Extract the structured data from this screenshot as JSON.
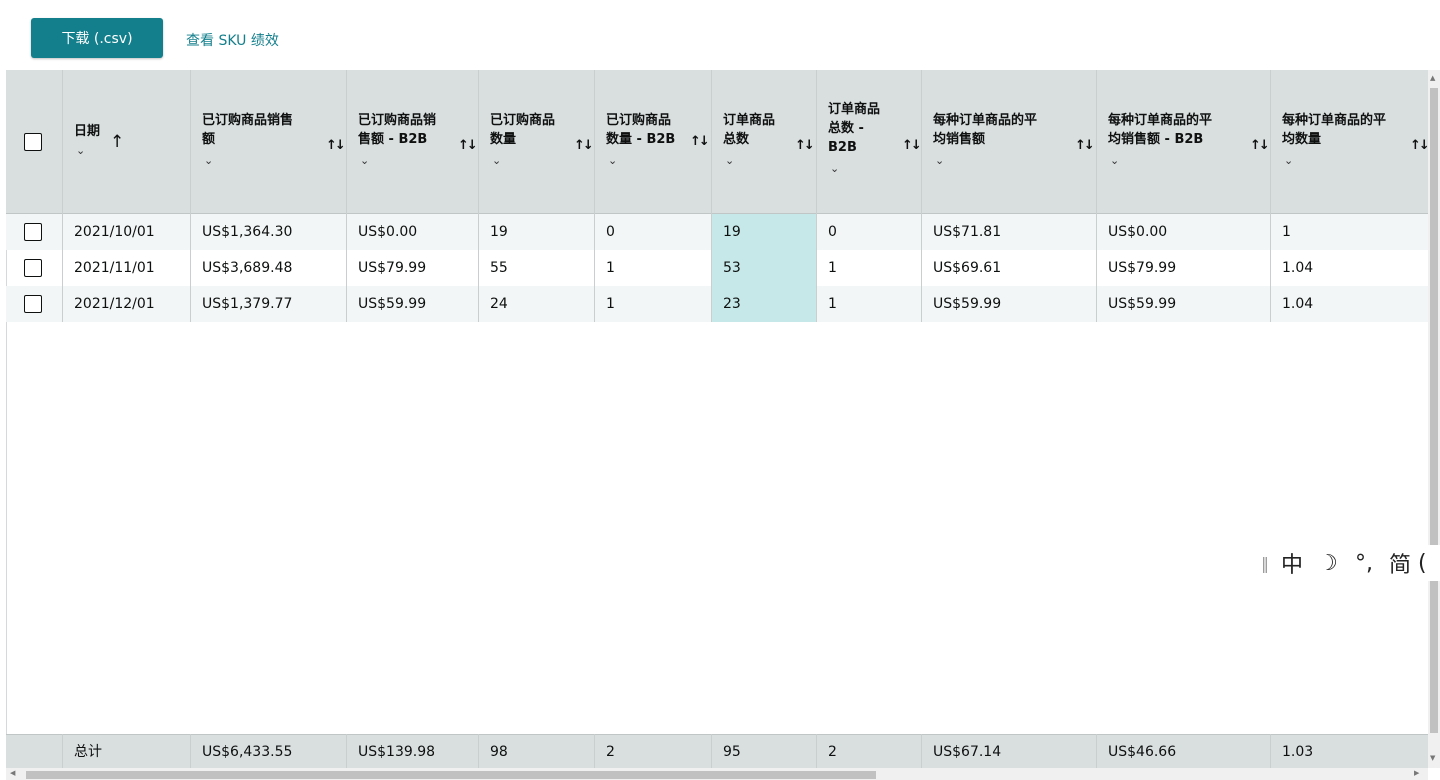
{
  "toolbar": {
    "download_label": "下载 (.csv)",
    "sku_link_label": "查看 SKU 绩效"
  },
  "table": {
    "headers": {
      "date": {
        "line1": "日期"
      },
      "ordered_sales": {
        "line1": "已订购商品销售",
        "line2": "额"
      },
      "ordered_sales_b2b": {
        "line1": "已订购商品销",
        "line2": "售额 - B2B"
      },
      "units_ordered": {
        "line1": "已订购商品",
        "line2": "数量"
      },
      "units_ordered_b2b": {
        "line1": "已订购商品",
        "line2": "数量 - B2B"
      },
      "total_order_items": {
        "line1": "订单商品",
        "line2": "总数"
      },
      "total_order_items_b2b": {
        "line1": "订单商品",
        "line2": "总数 -",
        "line3": "B2B"
      },
      "avg_sales_per_item": {
        "line1": "每种订单商品的平",
        "line2": "均销售额"
      },
      "avg_sales_per_item_b2b": {
        "line1": "每种订单商品的平",
        "line2": "均销售额 - B2B"
      },
      "avg_units_per_item": {
        "line1": "每种订单商品的平",
        "line2": "均数量"
      }
    },
    "sort_indicator_glyph": "↑↓",
    "asc_glyph": "↑",
    "chevron_glyph": "⌄",
    "rows": [
      {
        "date": "2021/10/01",
        "ordered_sales": "US$1,364.30",
        "ordered_sales_b2b": "US$0.00",
        "units_ordered": "19",
        "units_ordered_b2b": "0",
        "total_order_items": "19",
        "total_order_items_b2b": "0",
        "avg_sales_per_item": "US$71.81",
        "avg_sales_per_item_b2b": "US$0.00",
        "avg_units_per_item": "1"
      },
      {
        "date": "2021/11/01",
        "ordered_sales": "US$3,689.48",
        "ordered_sales_b2b": "US$79.99",
        "units_ordered": "55",
        "units_ordered_b2b": "1",
        "total_order_items": "53",
        "total_order_items_b2b": "1",
        "avg_sales_per_item": "US$69.61",
        "avg_sales_per_item_b2b": "US$79.99",
        "avg_units_per_item": "1.04"
      },
      {
        "date": "2021/12/01",
        "ordered_sales": "US$1,379.77",
        "ordered_sales_b2b": "US$59.99",
        "units_ordered": "24",
        "units_ordered_b2b": "1",
        "total_order_items": "23",
        "total_order_items_b2b": "1",
        "avg_sales_per_item": "US$59.99",
        "avg_sales_per_item_b2b": "US$59.99",
        "avg_units_per_item": "1.04"
      }
    ],
    "footer": {
      "label": "总计",
      "ordered_sales": "US$6,433.55",
      "ordered_sales_b2b": "US$139.98",
      "units_ordered": "98",
      "units_ordered_b2b": "2",
      "total_order_items": "95",
      "total_order_items_b2b": "2",
      "avg_sales_per_item": "US$67.14",
      "avg_sales_per_item_b2b": "US$46.66",
      "avg_units_per_item": "1.03"
    }
  },
  "ime_toolbar": {
    "handle": "‖",
    "mode": "中",
    "moon": "☽",
    "punct": "°,",
    "charset": "简",
    "more": "("
  },
  "colors": {
    "accent": "#137f8c",
    "header_bg": "#d9dede",
    "highlight_col": "#c6e8e8",
    "alt_row": "#f3f6f6"
  }
}
